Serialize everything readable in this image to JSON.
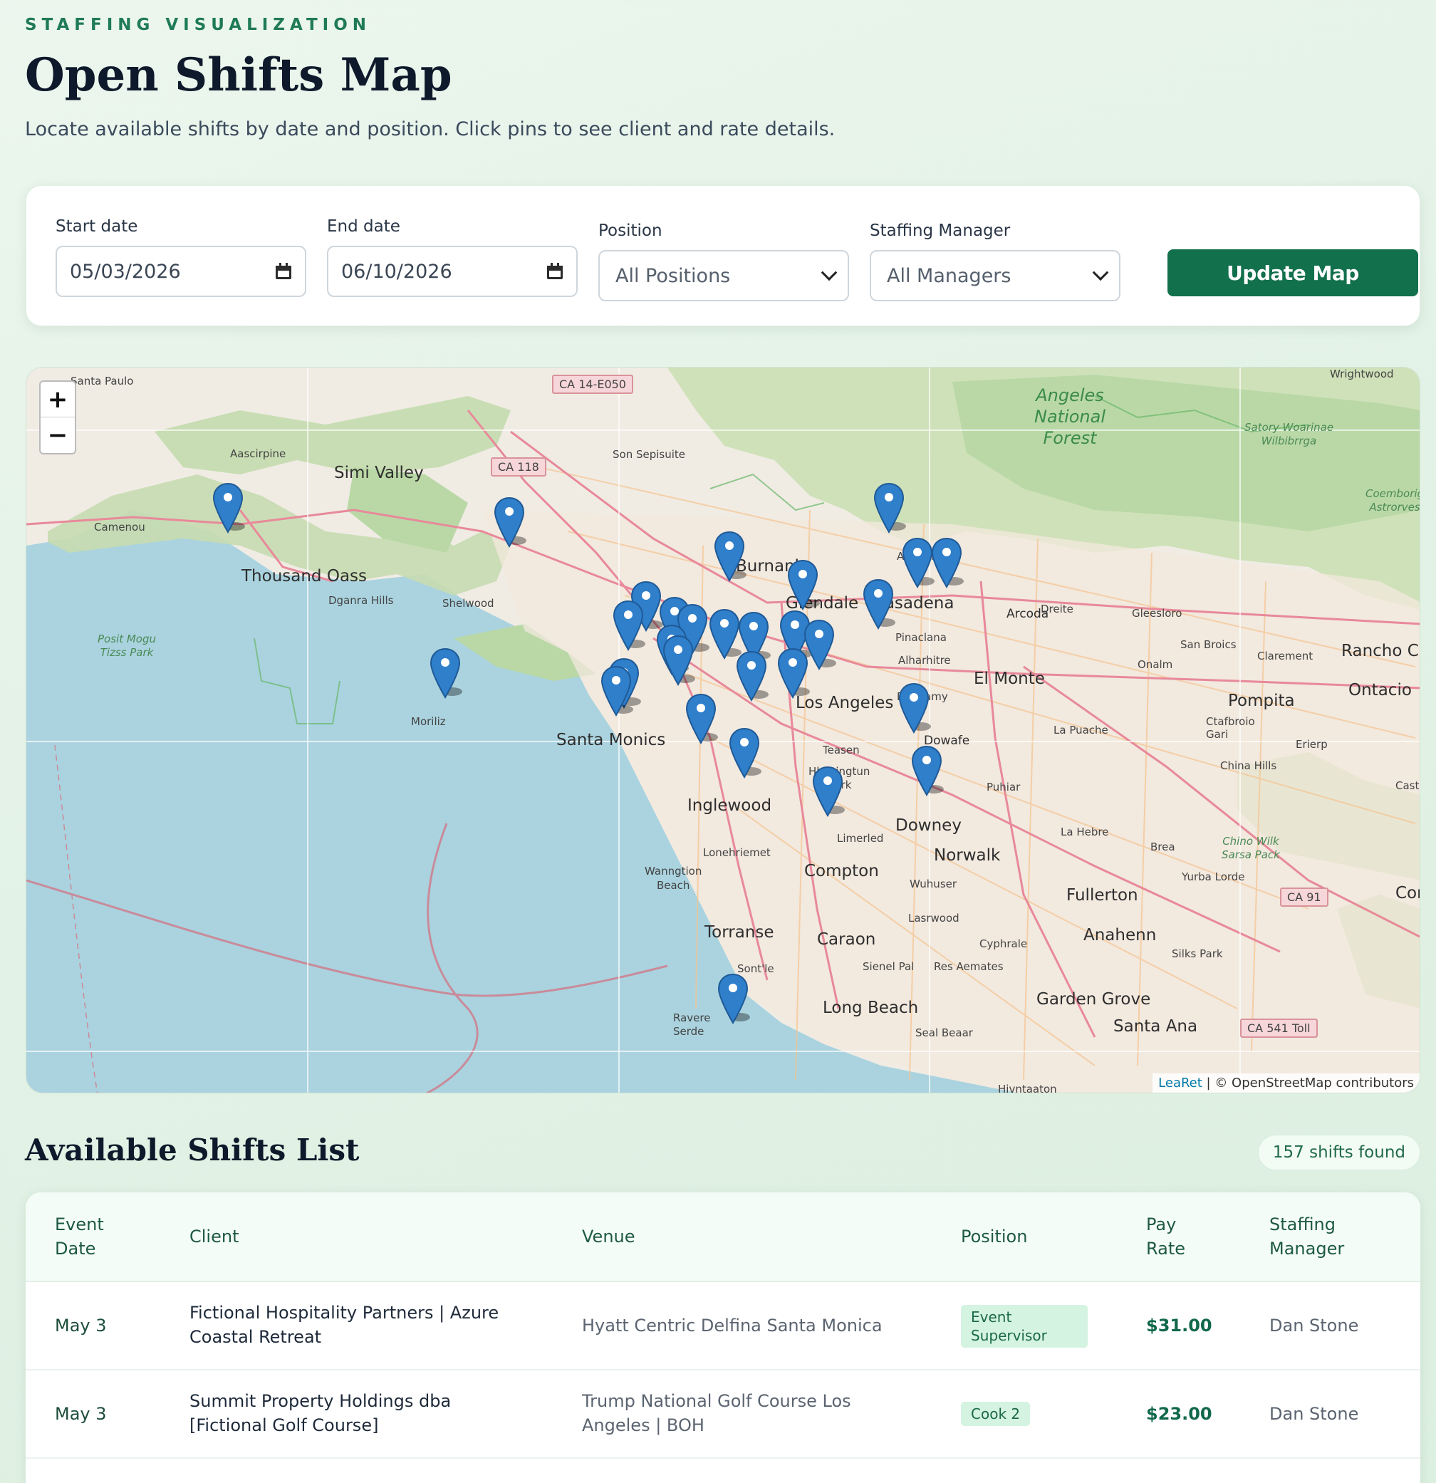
{
  "header": {
    "eyebrow": "STAFFING VISUALIZATION",
    "title": "Open Shifts Map",
    "subtitle": "Locate available shifts by date and position. Click pins to see client and rate details."
  },
  "filters": {
    "start_date_label": "Start date",
    "start_date_value": "05/03/2026",
    "end_date_label": "End date",
    "end_date_value": "06/10/2026",
    "position_label": "Position",
    "position_value": "All Positions",
    "manager_label": "Staffing Manager",
    "manager_value": "All Managers",
    "update_button": "Update Map"
  },
  "map": {
    "zoom_in": "+",
    "zoom_out": "−",
    "attribution_leaflet": "LeaRet",
    "attribution_rest": " | © OpenStreetMap contributors",
    "labels": {
      "santa_paulo": "Santa Paulo",
      "wrightwood": "Wrightwood",
      "angeles_forest": "Angeles\nNational\nForest",
      "satory": "Satory Woarinae\nWilbibrrga",
      "coemborig": "Coemborig\nAstrorves",
      "simi_valley": "Simi Valley",
      "aascirpine": "Aascirpine",
      "camenou": "Camenou",
      "thousand_oaks": "Thousand Oass",
      "dganra_hills": "Dganra Hills",
      "shelwood": "Shelwood",
      "sun_sepisuite": "Son Sepisuite",
      "burbank": "Burnank",
      "glendale": "Glendale",
      "pasadena": "Pasadena",
      "altadora": "Altadora",
      "arcoda": "Arcoda",
      "dreite": "Dreite",
      "gleesloro": "Gleesloro",
      "san_broics": "San Broics",
      "clarement": "Clarement",
      "rancho": "Rancho Cu",
      "onalm": "Onalm",
      "ontacio": "Ontacio",
      "pompita": "Pompita",
      "posit_mogu": "Posit Mogu\nTizss Park",
      "moriliz": "Moriliz",
      "santa_monica": "Santa Monics",
      "los_angeles": "Los Angeles",
      "pinaclana": "Pinaclana",
      "alhambra": "Alharhitre",
      "el_monte": "El Monte",
      "blontamy": "Blontamy",
      "la_puache": "La Puache",
      "ctafbroio": "Ctafbroio\nGari",
      "erierp": "Erierp",
      "chino_hills": "China Hills",
      "cast": "Cast",
      "downey_wafe": "Dowafe",
      "teasen": "Teasen",
      "huntington_park": "Hlastingtun\nBark",
      "puhiar": "Puhiar",
      "inglewood": "Inglewood",
      "limerled": "Limerled",
      "downey": "Downey",
      "la_hebre": "La Hebre",
      "brea": "Brea",
      "chino_wilk": "Chino Wilk\nSarsa Pack",
      "lonehriemet": "Lonehriemet",
      "wanngtion": "Wanngtion\nBeach",
      "compton": "Compton",
      "norwalk": "Norwalk",
      "wuhuser": "Wuhuser",
      "fullerton": "Fullerton",
      "yurba_lorde": "Yurba Lorde",
      "cor": "Cor",
      "torrance": "Torranse",
      "caraon": "Caraon",
      "lasrwood": "Lasrwood",
      "anahenn": "Anahenn",
      "cyphrale": "Cyphrale",
      "silks_park": "Silks Park",
      "sontle": "Sont'le",
      "sienel_pal": "Sienel Pal",
      "res_aematos": "Res Aemates",
      "long_beach": "Long Beach",
      "garden_grove": "Garden Grove",
      "santa_ana": "Santa Ana",
      "ravere_serde": "Ravere\nSerde",
      "seal_beach": "Seal Beaar",
      "huntington": "Hivntaaton"
    },
    "shields": {
      "ca14": "CA 14-E050",
      "ca118": "CA 118",
      "ca91": "CA 91",
      "ca241": "CA 541 Toll"
    }
  },
  "shifts": {
    "section_title": "Available Shifts List",
    "count": "157 shifts found",
    "columns": [
      "Event\nDate",
      "Client",
      "Venue",
      "Position",
      "Pay\nRate",
      "Staffing\nManager"
    ],
    "rows": [
      {
        "date": "May 3",
        "client": "Fictional Hospitality Partners | Azure Coastal Retreat",
        "venue": "Hyatt Centric Delfina Santa Monica",
        "position": "Event Supervisor",
        "rate": "$31.00",
        "manager": "Dan Stone"
      },
      {
        "date": "May 3",
        "client": "Summit Property Holdings dba [Fictional Golf Course]",
        "venue": "Trump National Golf Course Los Angeles | BOH",
        "position": "Cook 2",
        "rate": "$23.00",
        "manager": "Dan Stone"
      }
    ]
  },
  "colors": {
    "accent": "#12704d",
    "pin": "#2f7fcb",
    "badge_bg": "#d4f3e0",
    "water": "#aad3df",
    "park": "#b9d8a6"
  }
}
